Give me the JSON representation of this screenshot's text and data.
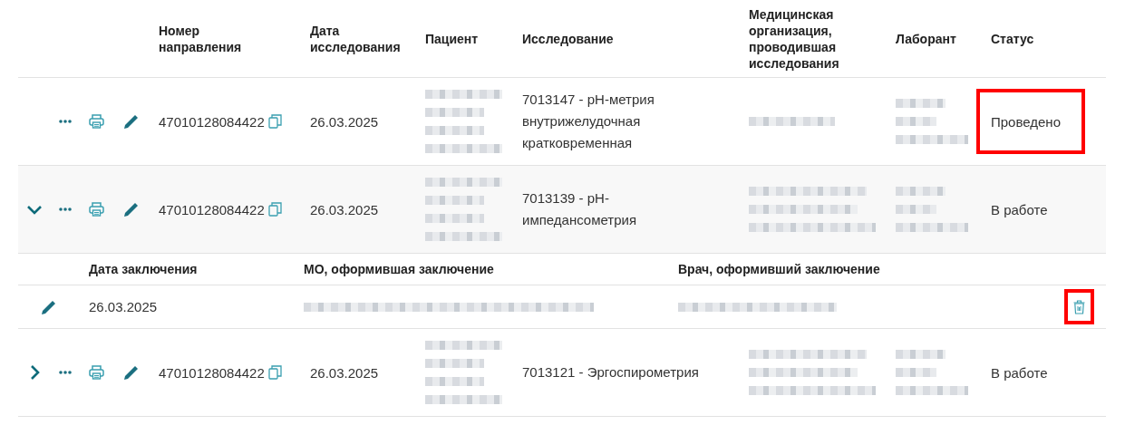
{
  "table": {
    "columns": [
      "Номер направления",
      "Дата исследования",
      "Пациент",
      "Исследование",
      "Медицинская организация, проводившая исследования",
      "Лаборант",
      "Статус"
    ],
    "rows": [
      {
        "number": "47010128084422",
        "date": "26.03.2025",
        "study": "7013147 - pH-метрия внутрижелудочная кратковременная",
        "status": "Проведено",
        "status_highlighted": true
      },
      {
        "expanded": true,
        "number": "47010128084422",
        "date": "26.03.2025",
        "study": "7013139 - pH-импедансометрия",
        "status": "В работе",
        "status_highlighted": false,
        "conclusion": {
          "columns": [
            "Дата заключения",
            "МО, оформившая заключение",
            "Врач, оформивший заключение"
          ],
          "date": "26.03.2025",
          "delete_highlighted": true
        }
      },
      {
        "expanded": false,
        "number": "47010128084422",
        "date": "26.03.2025",
        "study": "7013121 - Эргоспирометрия",
        "status": "В работе",
        "status_highlighted": false
      }
    ]
  }
}
